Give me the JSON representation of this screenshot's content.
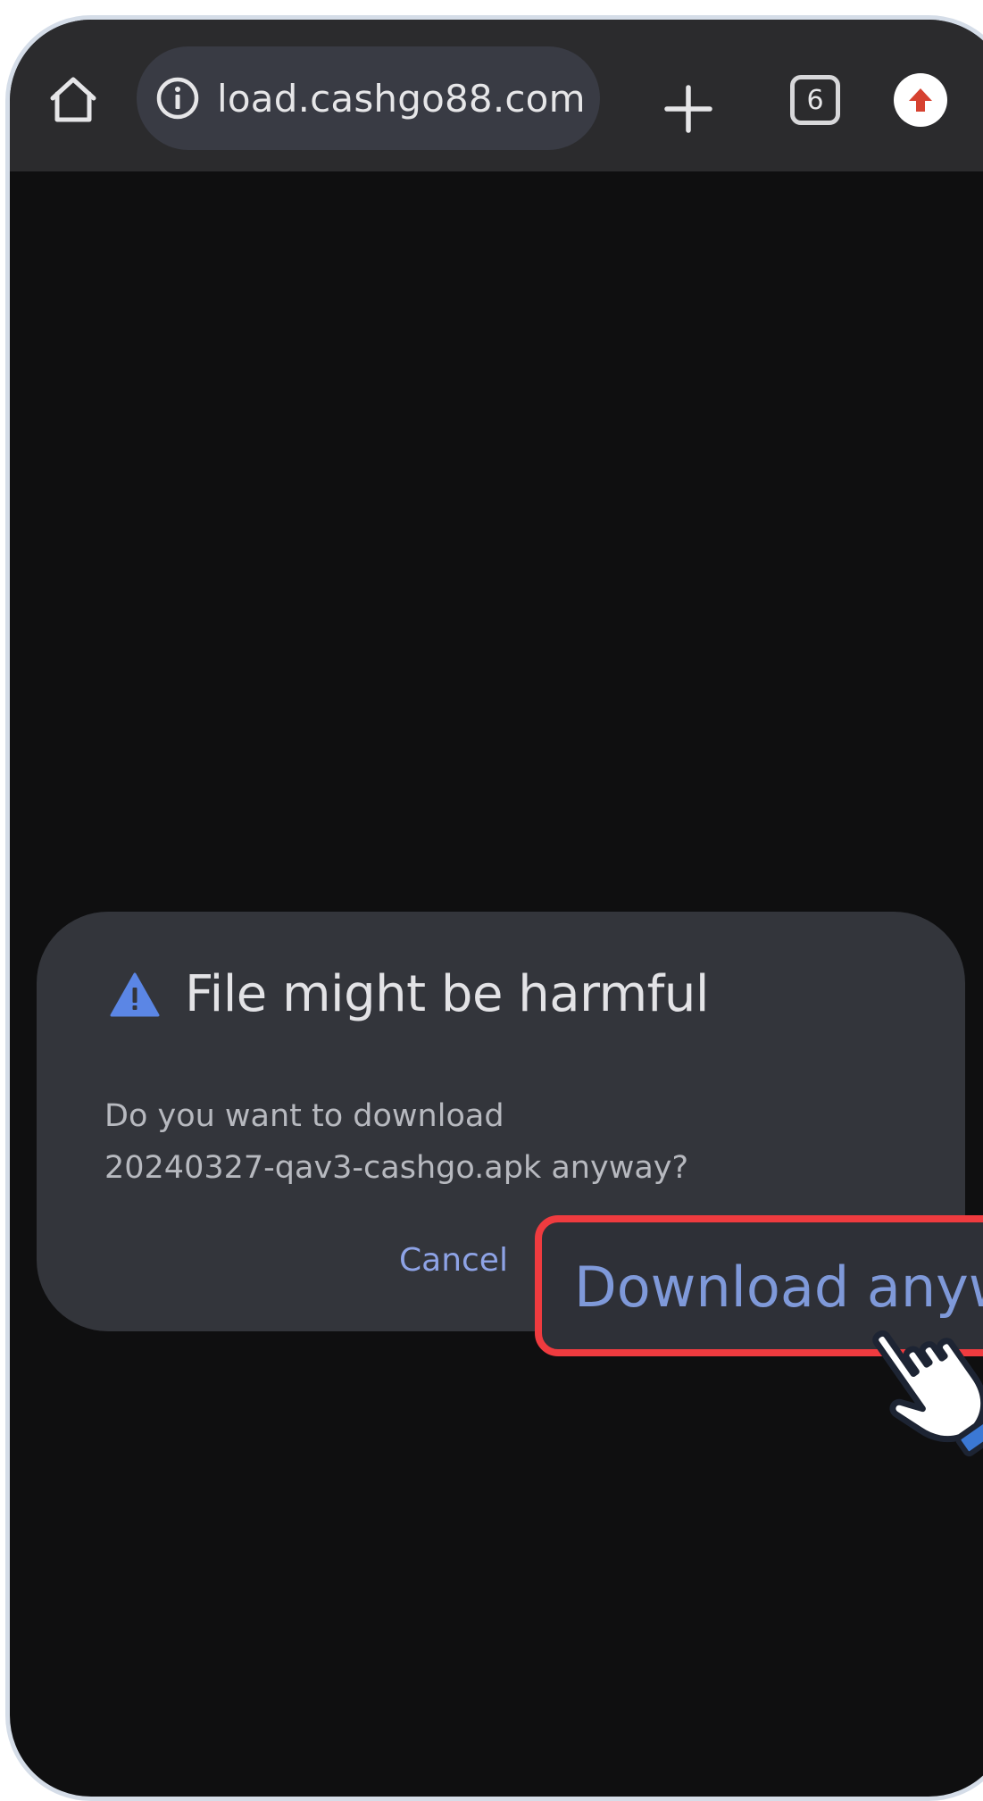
{
  "browser": {
    "url": "load.cashgo88.com",
    "tab_count": "6"
  },
  "dialog": {
    "title": "File might be harmful",
    "body_line1": "Do you want to download",
    "body_line2": "20240327-qav3-cashgo.apk anyway?",
    "cancel_label": "Cancel",
    "download_label": "Download anyway"
  },
  "colors": {
    "toolbar_bg": "#2b2b2d",
    "page_bg": "#0f0f10",
    "dialog_bg": "#33353b",
    "accent": "#8ea3e6",
    "highlight_border": "#ef3b3f",
    "warning_icon": "#5b86e5"
  },
  "icons": {
    "home": "home-icon",
    "info": "info-icon",
    "new_tab": "plus-icon",
    "update": "update-arrow-icon",
    "warning": "warning-triangle-icon",
    "pointer": "hand-pointer-icon"
  }
}
